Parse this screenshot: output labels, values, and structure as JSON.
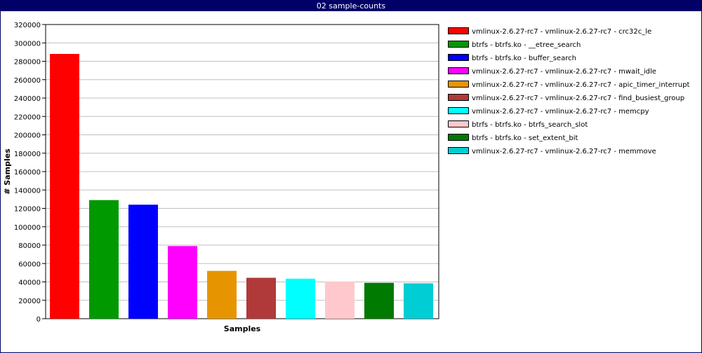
{
  "window": {
    "title": "02 sample-counts"
  },
  "chart_data": {
    "type": "bar",
    "title": "",
    "xlabel": "Samples",
    "ylabel": "# Samples",
    "ylim": [
      0,
      320000
    ],
    "ytick_step": 20000,
    "yticks": [
      "0",
      "20000",
      "40000",
      "60000",
      "80000",
      "100000",
      "120000",
      "140000",
      "160000",
      "180000",
      "200000",
      "220000",
      "240000",
      "260000",
      "280000",
      "300000",
      "320000"
    ],
    "grid": true,
    "legend_position": "right",
    "series": [
      {
        "name": "vmlinux-2.6.27-rc7 - vmlinux-2.6.27-rc7 - crc32c_le",
        "value": 288000,
        "color": "#ff0000"
      },
      {
        "name": "btrfs - btrfs.ko - __etree_search",
        "value": 129000,
        "color": "#009900"
      },
      {
        "name": "btrfs - btrfs.ko - buffer_search",
        "value": 124000,
        "color": "#0000ff"
      },
      {
        "name": "vmlinux-2.6.27-rc7 - vmlinux-2.6.27-rc7 - mwait_idle",
        "value": 79000,
        "color": "#ff00ff"
      },
      {
        "name": "vmlinux-2.6.27-rc7 - vmlinux-2.6.27-rc7 - apic_timer_interrupt",
        "value": 52000,
        "color": "#e69500"
      },
      {
        "name": "vmlinux-2.6.27-rc7 - vmlinux-2.6.27-rc7 - find_busiest_group",
        "value": 44500,
        "color": "#b03a3a"
      },
      {
        "name": "vmlinux-2.6.27-rc7 - vmlinux-2.6.27-rc7 - memcpy",
        "value": 43500,
        "color": "#00ffff"
      },
      {
        "name": "btrfs - btrfs.ko - btrfs_search_slot",
        "value": 40500,
        "color": "#ffc8cc"
      },
      {
        "name": "btrfs - btrfs.ko - set_extent_bit",
        "value": 39000,
        "color": "#007a00"
      },
      {
        "name": "vmlinux-2.6.27-rc7 - vmlinux-2.6.27-rc7 - memmove",
        "value": 38500,
        "color": "#00cdd4"
      }
    ]
  }
}
